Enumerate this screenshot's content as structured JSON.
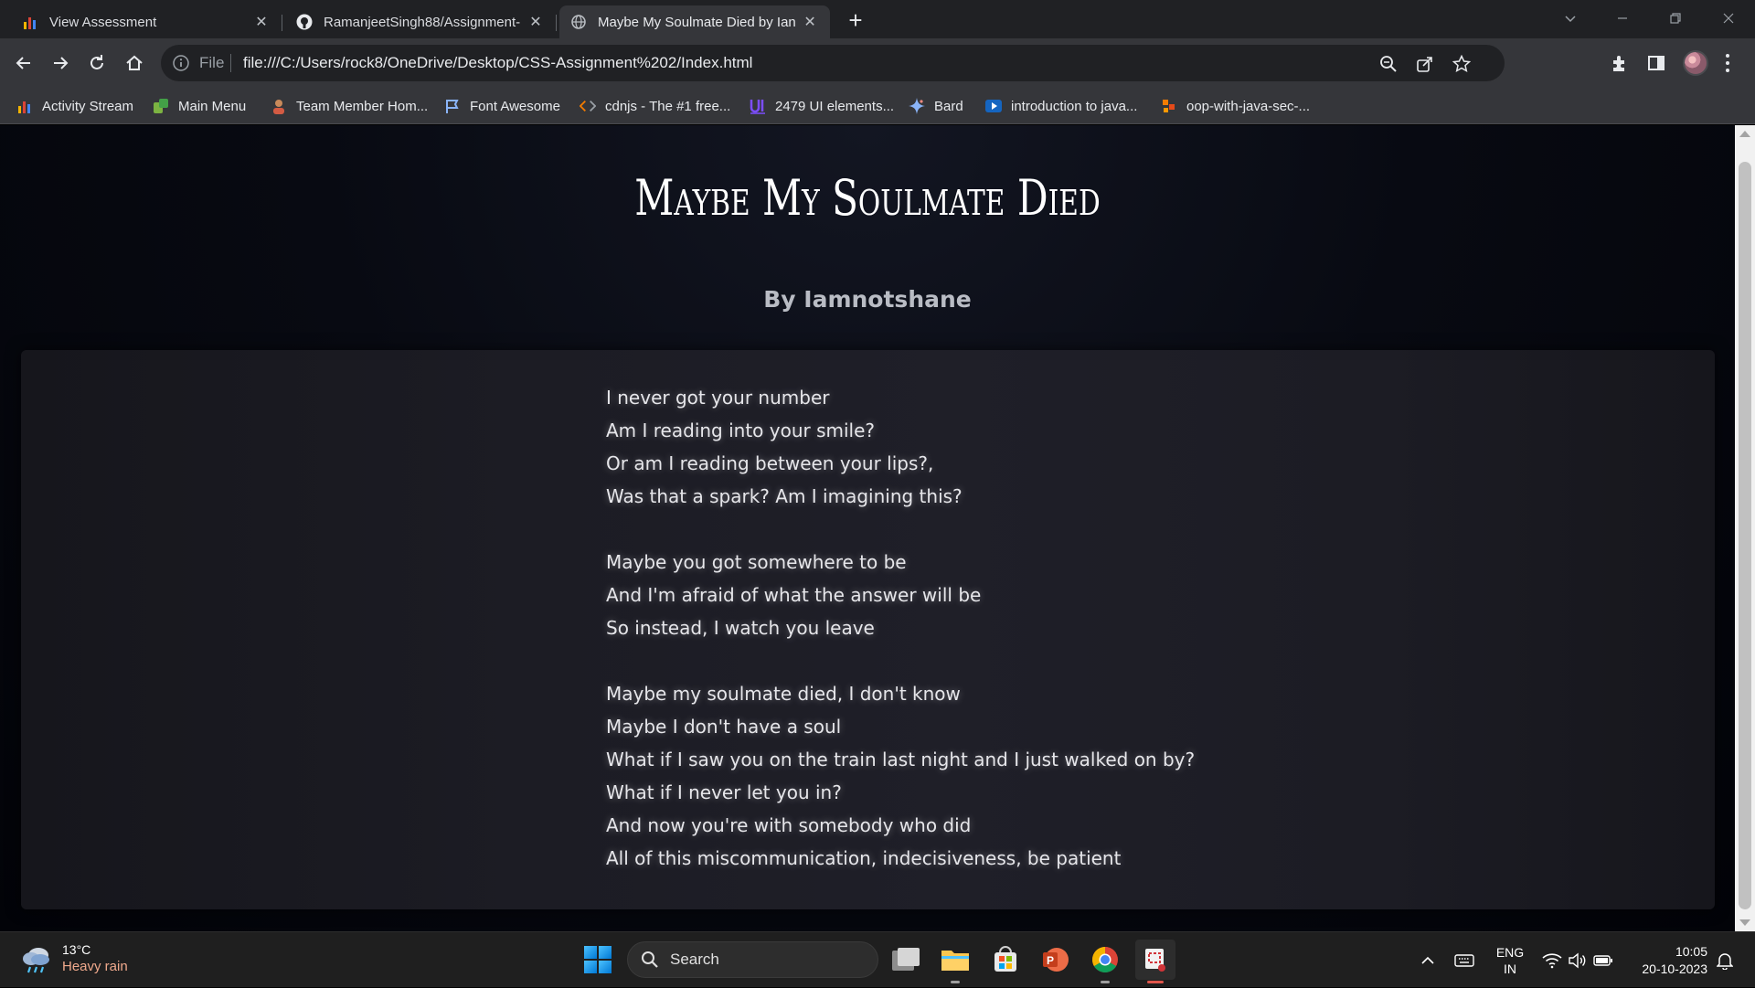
{
  "browser": {
    "tabs": [
      {
        "title": "View Assessment",
        "favicon": "bar-chart-icon",
        "close": "✕"
      },
      {
        "title": "RamanjeetSingh88/Assignment-",
        "favicon": "github-icon",
        "close": "✕"
      },
      {
        "title": "Maybe My Soulmate Died by Ian",
        "favicon": "globe-icon",
        "close": "✕"
      }
    ],
    "new_tab": "+",
    "address": {
      "scheme_label": "File",
      "url": "file:///C:/Users/rock8/OneDrive/Desktop/CSS-Assignment%202/Index.html"
    },
    "bookmarks": [
      {
        "label": "Activity Stream",
        "icon": "bar-chart-icon"
      },
      {
        "label": "Main Menu",
        "icon": "app-icon"
      },
      {
        "label": "Team Member Hom...",
        "icon": "avatar-icon"
      },
      {
        "label": "Font Awesome",
        "icon": "flag-icon"
      },
      {
        "label": "cdnjs - The #1 free...",
        "icon": "code-icon"
      },
      {
        "label": "2479 UI elements...",
        "icon": "ui-logo-icon"
      },
      {
        "label": "Bard",
        "icon": "sparkle-icon"
      },
      {
        "label": "introduction to java...",
        "icon": "play-icon"
      },
      {
        "label": "oop-with-java-sec-...",
        "icon": "puzzle-logo-icon"
      }
    ]
  },
  "page": {
    "title": "Maybe My Soulmate Died",
    "author": "By Iamnotshane",
    "stanzas": [
      [
        "I never got your number",
        "Am I reading into your smile?",
        "Or am I reading between your lips?,",
        "Was that a spark? Am I imagining this?"
      ],
      [
        "Maybe you got somewhere to be",
        "And I'm afraid of what the answer will be",
        "So instead, I watch you leave"
      ],
      [
        "Maybe my soulmate died, I don't know",
        "Maybe I don't have a soul",
        "What if I saw you on the train last night and I just walked on by?",
        "What if I never let you in?",
        "And now you're with somebody who did",
        "All of this miscommunication, indecisiveness, be patient"
      ]
    ]
  },
  "taskbar": {
    "weather": {
      "temp": "13°C",
      "condition": "Heavy rain"
    },
    "search_label": "Search",
    "language": {
      "line1": "ENG",
      "line2": "IN"
    },
    "time": "10:05",
    "date": "20-10-2023"
  },
  "colors": {
    "chrome_dark": "#202124",
    "chrome_toolbar": "#35363a",
    "page_bg": "#05060c",
    "card_bg": "#1c1c24",
    "text_light": "#e6e6ea",
    "weather_accent": "#f0a98c"
  }
}
